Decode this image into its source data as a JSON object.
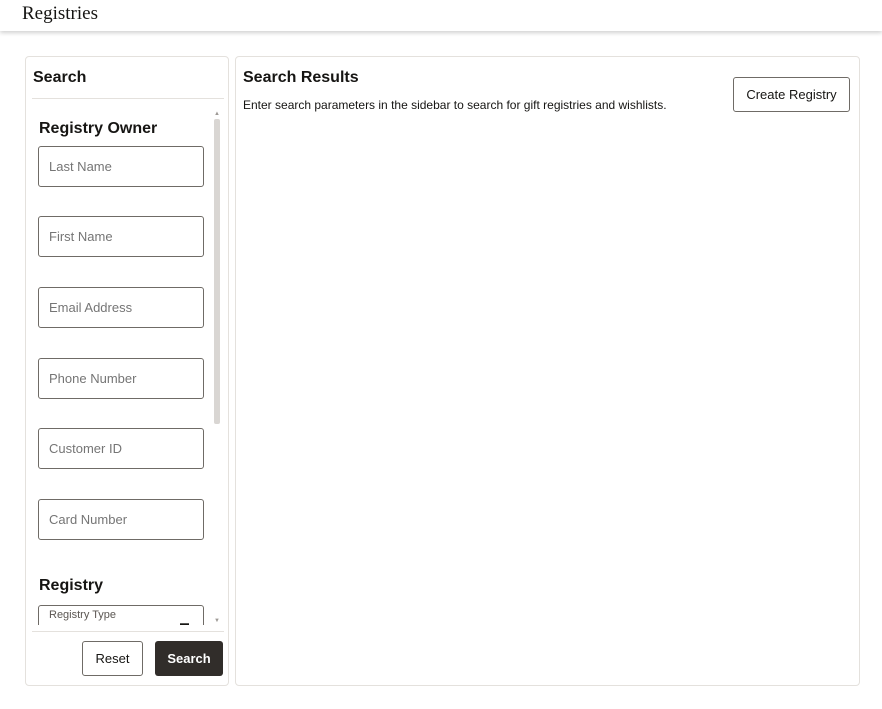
{
  "header": {
    "title": "Registries"
  },
  "sidebar": {
    "title": "Search",
    "registry_owner": {
      "heading": "Registry Owner",
      "fields": {
        "last_name": "Last Name",
        "first_name": "First Name",
        "email": "Email Address",
        "phone": "Phone Number",
        "customer_id": "Customer ID",
        "card_number": "Card Number"
      }
    },
    "registry": {
      "heading": "Registry",
      "type_placeholder": "Registry Type"
    },
    "reset_label": "Reset",
    "search_label": "Search"
  },
  "main": {
    "title": "Search Results",
    "description": "Enter search parameters in the sidebar to search for gift registries and wishlists.",
    "create_label": "Create Registry"
  },
  "colors": {
    "primary_button": "#312d2a",
    "border": "#e4e1dd",
    "field_border": "#6f6b66"
  }
}
